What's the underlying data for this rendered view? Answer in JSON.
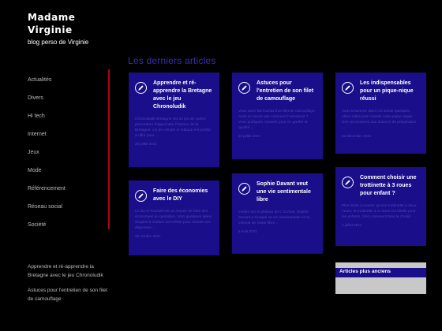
{
  "site": {
    "title": "Madame Virginie",
    "description": "blog perso de Virginie"
  },
  "nav": {
    "items": [
      "Actualités",
      "Divers",
      "Hi tech",
      "Internet",
      "Jeux",
      "Mode",
      "Référencement",
      "Réseau social",
      "Société"
    ]
  },
  "recent_posts": [
    "Apprendre et ré-apprendre la Bretagne avec le jeu Chronoludik",
    "Astuces pour l'entretien de son filet de camouflage"
  ],
  "main": {
    "section_title": "Les derniers articles",
    "cards": [
      {
        "title": "Apprendre et ré-apprendre la Bretagne avec le jeu Chronoludik",
        "excerpt": "Chronoludik Bretagne est un jeu de cartes permettant d'apprendre l'histoire de la Bretagne. Ce jeu simple et ludique est parfait à offrir pour ...",
        "date": "20 juillet 2022"
      },
      {
        "title": "Astuces pour l'entretien de son filet de camouflage",
        "excerpt": "Vous avez fait l'achat d'un filet de camouflage mais ne savez pas comment l'entretenir ? Voici quelques conseils pour en garder la qualité ...",
        "date": "20 juillet 2022"
      },
      {
        "title": "Les indispensables pour un pique-nique réussi",
        "excerpt": "Vous trouverez dans cet article quelques idées utiles pour réussir votre pique-nique. Des accessoires aux astuces de préparation ...",
        "date": "22 décembre 2021"
      },
      {
        "title": "Faire des économies avec le DIY",
        "excerpt": "Le Do-It-Yourself est un moyen de faire des économies au quotidien. Voici quelques idées simples à réaliser soi-même pour réduire vos dépenses ...",
        "date": "28 octobre 2021"
      },
      {
        "title": "Sophie Davant veut une vie sentimentale libre",
        "excerpt": "Invitée sur le plateau de C à vous, Sophie Davant a évoqué sa vie sentimentale et sa volonté de rester libre ...",
        "date": "5 août 2021"
      },
      {
        "title": "Comment choisir une trottinette à 3 roues pour enfant ?",
        "excerpt": "Plus facile à manier qu'une trottinette à deux roues, la trottinette à 3 roues est idéale pour les enfants. Voici comment bien la choisir ...",
        "date": "1 juillet 2021"
      }
    ]
  },
  "widget": {
    "title": "Articles plus anciens"
  },
  "colors": {
    "background": "#000000",
    "card": "#1a0e8a",
    "accent_bar": "#b00011",
    "section_title": "#3a2fb0"
  }
}
